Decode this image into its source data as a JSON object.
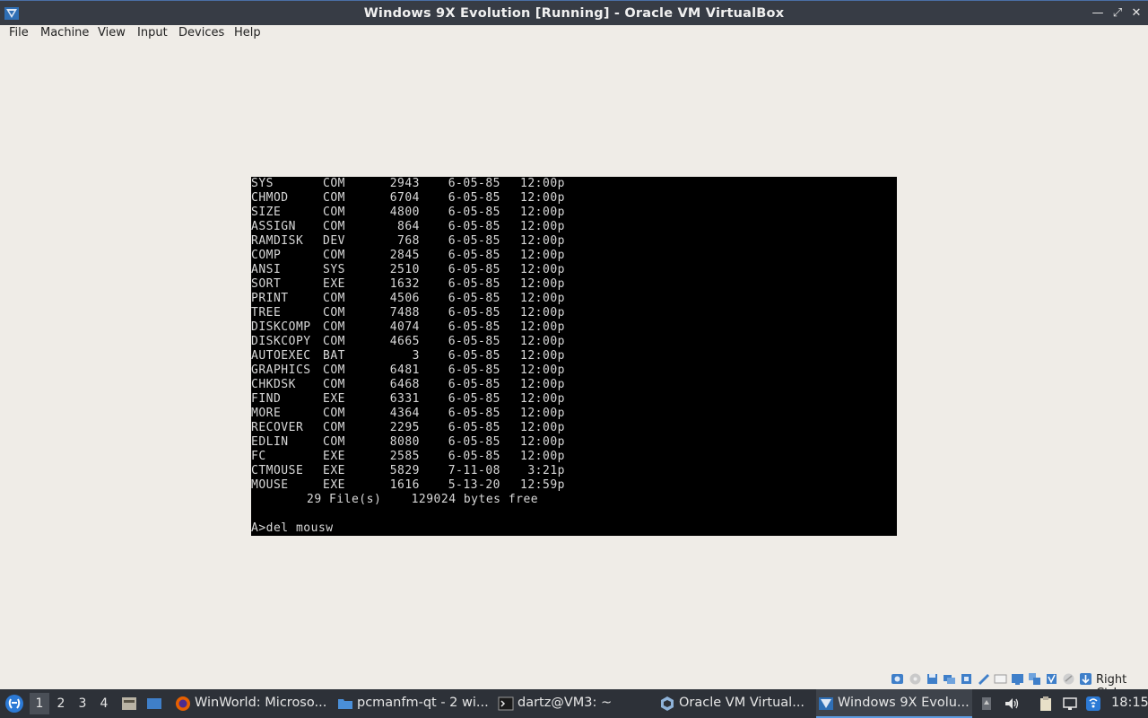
{
  "window": {
    "title": "Windows 9X Evolution [Running] - Oracle VM VirtualBox",
    "controls": [
      "minimize-icon",
      "maximize-icon",
      "close-icon"
    ]
  },
  "menu": {
    "items": [
      "File",
      "Machine",
      "View",
      "Input",
      "Devices",
      "Help"
    ]
  },
  "vm": {
    "listing": [
      {
        "name": "SYS",
        "ext": "COM",
        "size": "2943",
        "date": "6-05-85",
        "time": "12:00p"
      },
      {
        "name": "CHMOD",
        "ext": "COM",
        "size": "6704",
        "date": "6-05-85",
        "time": "12:00p"
      },
      {
        "name": "SIZE",
        "ext": "COM",
        "size": "4800",
        "date": "6-05-85",
        "time": "12:00p"
      },
      {
        "name": "ASSIGN",
        "ext": "COM",
        "size": "864",
        "date": "6-05-85",
        "time": "12:00p"
      },
      {
        "name": "RAMDISK",
        "ext": "DEV",
        "size": "768",
        "date": "6-05-85",
        "time": "12:00p"
      },
      {
        "name": "COMP",
        "ext": "COM",
        "size": "2845",
        "date": "6-05-85",
        "time": "12:00p"
      },
      {
        "name": "ANSI",
        "ext": "SYS",
        "size": "2510",
        "date": "6-05-85",
        "time": "12:00p"
      },
      {
        "name": "SORT",
        "ext": "EXE",
        "size": "1632",
        "date": "6-05-85",
        "time": "12:00p"
      },
      {
        "name": "PRINT",
        "ext": "COM",
        "size": "4506",
        "date": "6-05-85",
        "time": "12:00p"
      },
      {
        "name": "TREE",
        "ext": "COM",
        "size": "7488",
        "date": "6-05-85",
        "time": "12:00p"
      },
      {
        "name": "DISKCOMP",
        "ext": "COM",
        "size": "4074",
        "date": "6-05-85",
        "time": "12:00p"
      },
      {
        "name": "DISKCOPY",
        "ext": "COM",
        "size": "4665",
        "date": "6-05-85",
        "time": "12:00p"
      },
      {
        "name": "AUTOEXEC",
        "ext": "BAT",
        "size": "3",
        "date": "6-05-85",
        "time": "12:00p"
      },
      {
        "name": "GRAPHICS",
        "ext": "COM",
        "size": "6481",
        "date": "6-05-85",
        "time": "12:00p"
      },
      {
        "name": "CHKDSK",
        "ext": "COM",
        "size": "6468",
        "date": "6-05-85",
        "time": "12:00p"
      },
      {
        "name": "FIND",
        "ext": "EXE",
        "size": "6331",
        "date": "6-05-85",
        "time": "12:00p"
      },
      {
        "name": "MORE",
        "ext": "COM",
        "size": "4364",
        "date": "6-05-85",
        "time": "12:00p"
      },
      {
        "name": "RECOVER",
        "ext": "COM",
        "size": "2295",
        "date": "6-05-85",
        "time": "12:00p"
      },
      {
        "name": "EDLIN",
        "ext": "COM",
        "size": "8080",
        "date": "6-05-85",
        "time": "12:00p"
      },
      {
        "name": "FC",
        "ext": "EXE",
        "size": "2585",
        "date": "6-05-85",
        "time": "12:00p"
      },
      {
        "name": "CTMOUSE",
        "ext": "EXE",
        "size": "5829",
        "date": "7-11-08",
        "time": "3:21p"
      },
      {
        "name": "MOUSE",
        "ext": "EXE",
        "size": "1616",
        "date": "5-13-20",
        "time": "12:59p"
      }
    ],
    "summary": "29 File(s)    129024 bytes free",
    "prompt": "A>del mousw"
  },
  "statusbar": {
    "host_key": "Right Ctrl",
    "icons": [
      "optical-drive-icon",
      "audio-icon",
      "floppy-icon",
      "network-icon",
      "usb-icon",
      "shared-folders-icon",
      "display-icon",
      "recording-icon",
      "vt-icon",
      "cpu-icon",
      "mouse-integration-icon",
      "keyboard-icon"
    ]
  },
  "taskbar": {
    "desktops": [
      "1",
      "2",
      "3",
      "4"
    ],
    "active_desktop": "1",
    "tasks": [
      {
        "label": "WinWorld: Microso...",
        "icon": "firefox-icon"
      },
      {
        "label": "pcmanfm-qt - 2 wi...",
        "icon": "folder-icon"
      },
      {
        "label": "dartz@VM3: ~",
        "icon": "terminal-icon"
      },
      {
        "label": "Oracle VM Virtual...",
        "icon": "virtualbox-icon"
      },
      {
        "label": "Windows 9X Evolu...",
        "icon": "vm-window-icon"
      }
    ],
    "active_task": "Windows 9X Evolu...",
    "clock": "18:15"
  }
}
